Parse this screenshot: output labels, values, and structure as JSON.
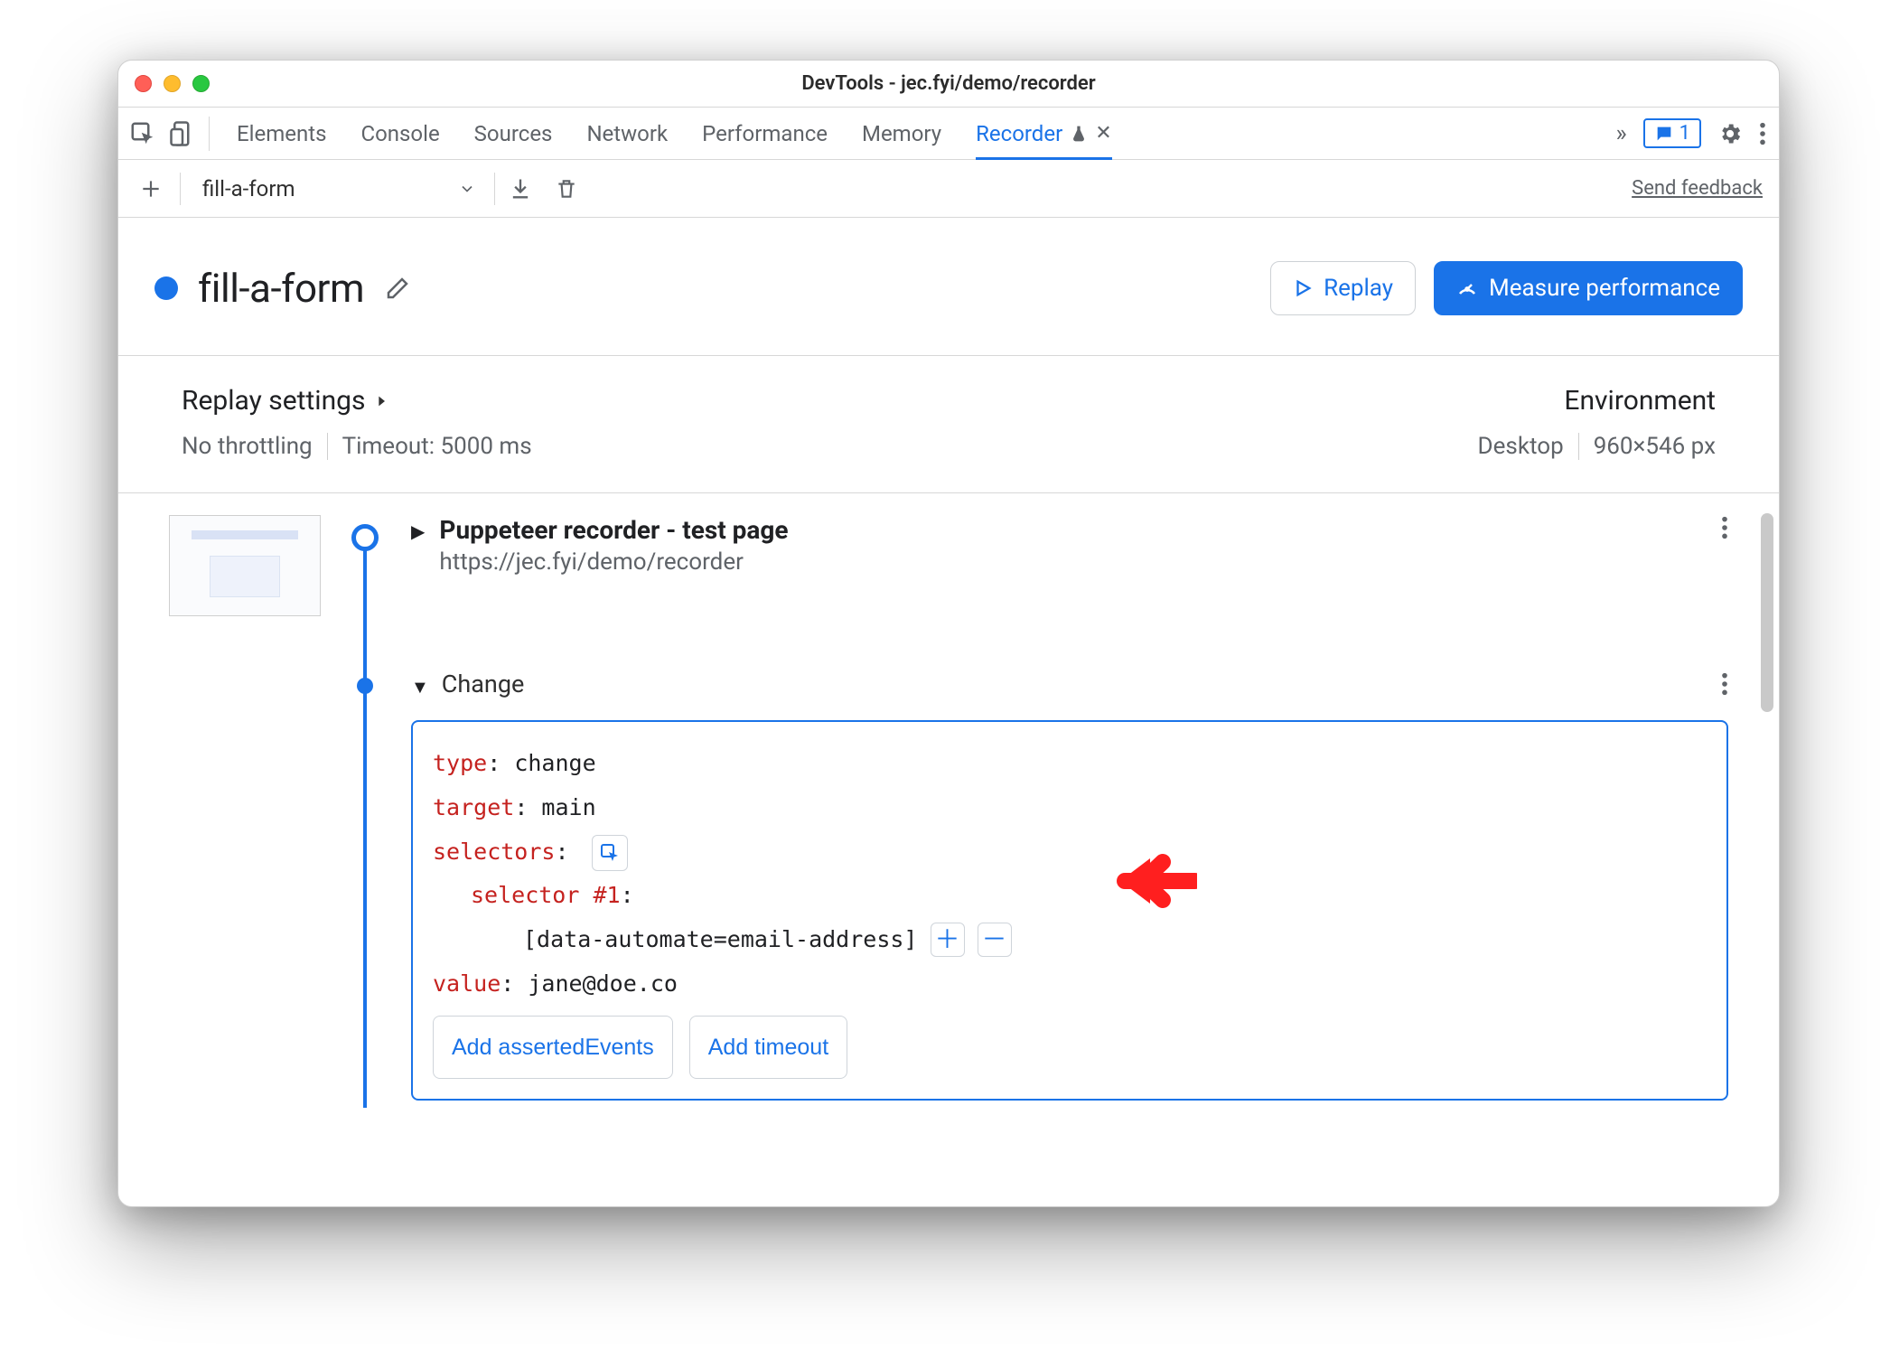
{
  "window": {
    "title": "DevTools - jec.fyi/demo/recorder"
  },
  "tabs": {
    "items": [
      "Elements",
      "Console",
      "Sources",
      "Network",
      "Performance",
      "Memory",
      "Recorder"
    ],
    "active": "Recorder",
    "issues_count": "1"
  },
  "secbar": {
    "recording_name": "fill-a-form",
    "feedback_label": "Send feedback"
  },
  "flow": {
    "title": "fill-a-form",
    "replay_label": "Replay",
    "measure_label": "Measure performance"
  },
  "settings": {
    "replay_head": "Replay settings",
    "throttling": "No throttling",
    "timeout": "Timeout: 5000 ms",
    "env_head": "Environment",
    "device": "Desktop",
    "dimensions": "960×546 px"
  },
  "steps": {
    "first": {
      "title": "Puppeteer recorder - test page",
      "url": "https://jec.fyi/demo/recorder"
    },
    "change_label": "Change",
    "props": {
      "type_k": "type",
      "type_v": "change",
      "target_k": "target",
      "target_v": "main",
      "selectors_k": "selectors",
      "selector1_k": "selector #1",
      "selector1_v": "[data-automate=email-address]",
      "value_k": "value",
      "value_v": "jane@doe.co"
    },
    "chips": {
      "events": "Add assertedEvents",
      "timeout": "Add timeout"
    }
  }
}
